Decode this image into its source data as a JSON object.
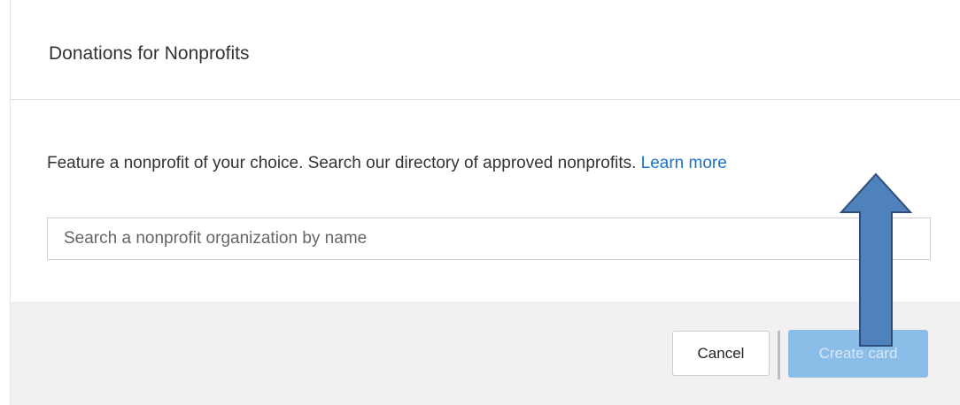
{
  "dialog": {
    "title": "Donations for Nonprofits",
    "description": "Feature a nonprofit of your choice. Search our directory of approved nonprofits.",
    "learn_more_label": "Learn more",
    "search": {
      "placeholder": "Search a nonprofit organization by name",
      "value": ""
    },
    "buttons": {
      "cancel_label": "Cancel",
      "create_label": "Create card"
    }
  },
  "annotation": {
    "icon": "up-arrow-icon",
    "fill_color": "#4f81bd",
    "stroke_color": "#2f4f7a"
  },
  "colors": {
    "link": "#1a73c8",
    "create_button": "#8bbde9",
    "footer_background": "#f1f1f1"
  }
}
